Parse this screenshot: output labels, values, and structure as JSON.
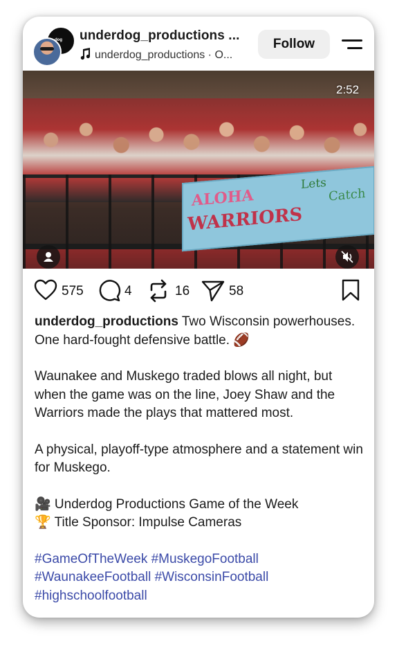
{
  "header": {
    "username": "underdog_productions ...",
    "audio_label": "underdog_productions · O...",
    "follow_label": "Follow",
    "avatar_badge_text": "dog"
  },
  "media": {
    "duration": "2:52",
    "banner_text_1": "ALOHA",
    "banner_text_2": "WARRIORS",
    "banner_text_3": "Lets",
    "banner_text_4": "Catch",
    "muted": true
  },
  "actions": {
    "likes": "575",
    "comments": "4",
    "reposts": "16",
    "shares": "58"
  },
  "caption": {
    "username": "underdog_productions",
    "line1": "Two Wisconsin powerhouses. One hard-fought defensive battle. 🏈",
    "para2": "Waunakee and Muskego traded blows all night, but when the game was on the line, Joey Shaw and the Warriors made the plays that mattered most.",
    "para3": "A physical, playoff-type atmosphere and a statement win for Muskego.",
    "credit1": "🎥 Underdog Productions Game of the Week",
    "credit2": "🏆 Title Sponsor: Impulse Cameras",
    "hashtags": [
      "#GameOfTheWeek",
      "#MuskegoFootball",
      "#WaunakeeFootball",
      "#WisconsinFootball",
      "#highschoolfootball"
    ]
  },
  "colors": {
    "hashtag": "#3b4aa8",
    "follow_bg": "#efefef"
  }
}
